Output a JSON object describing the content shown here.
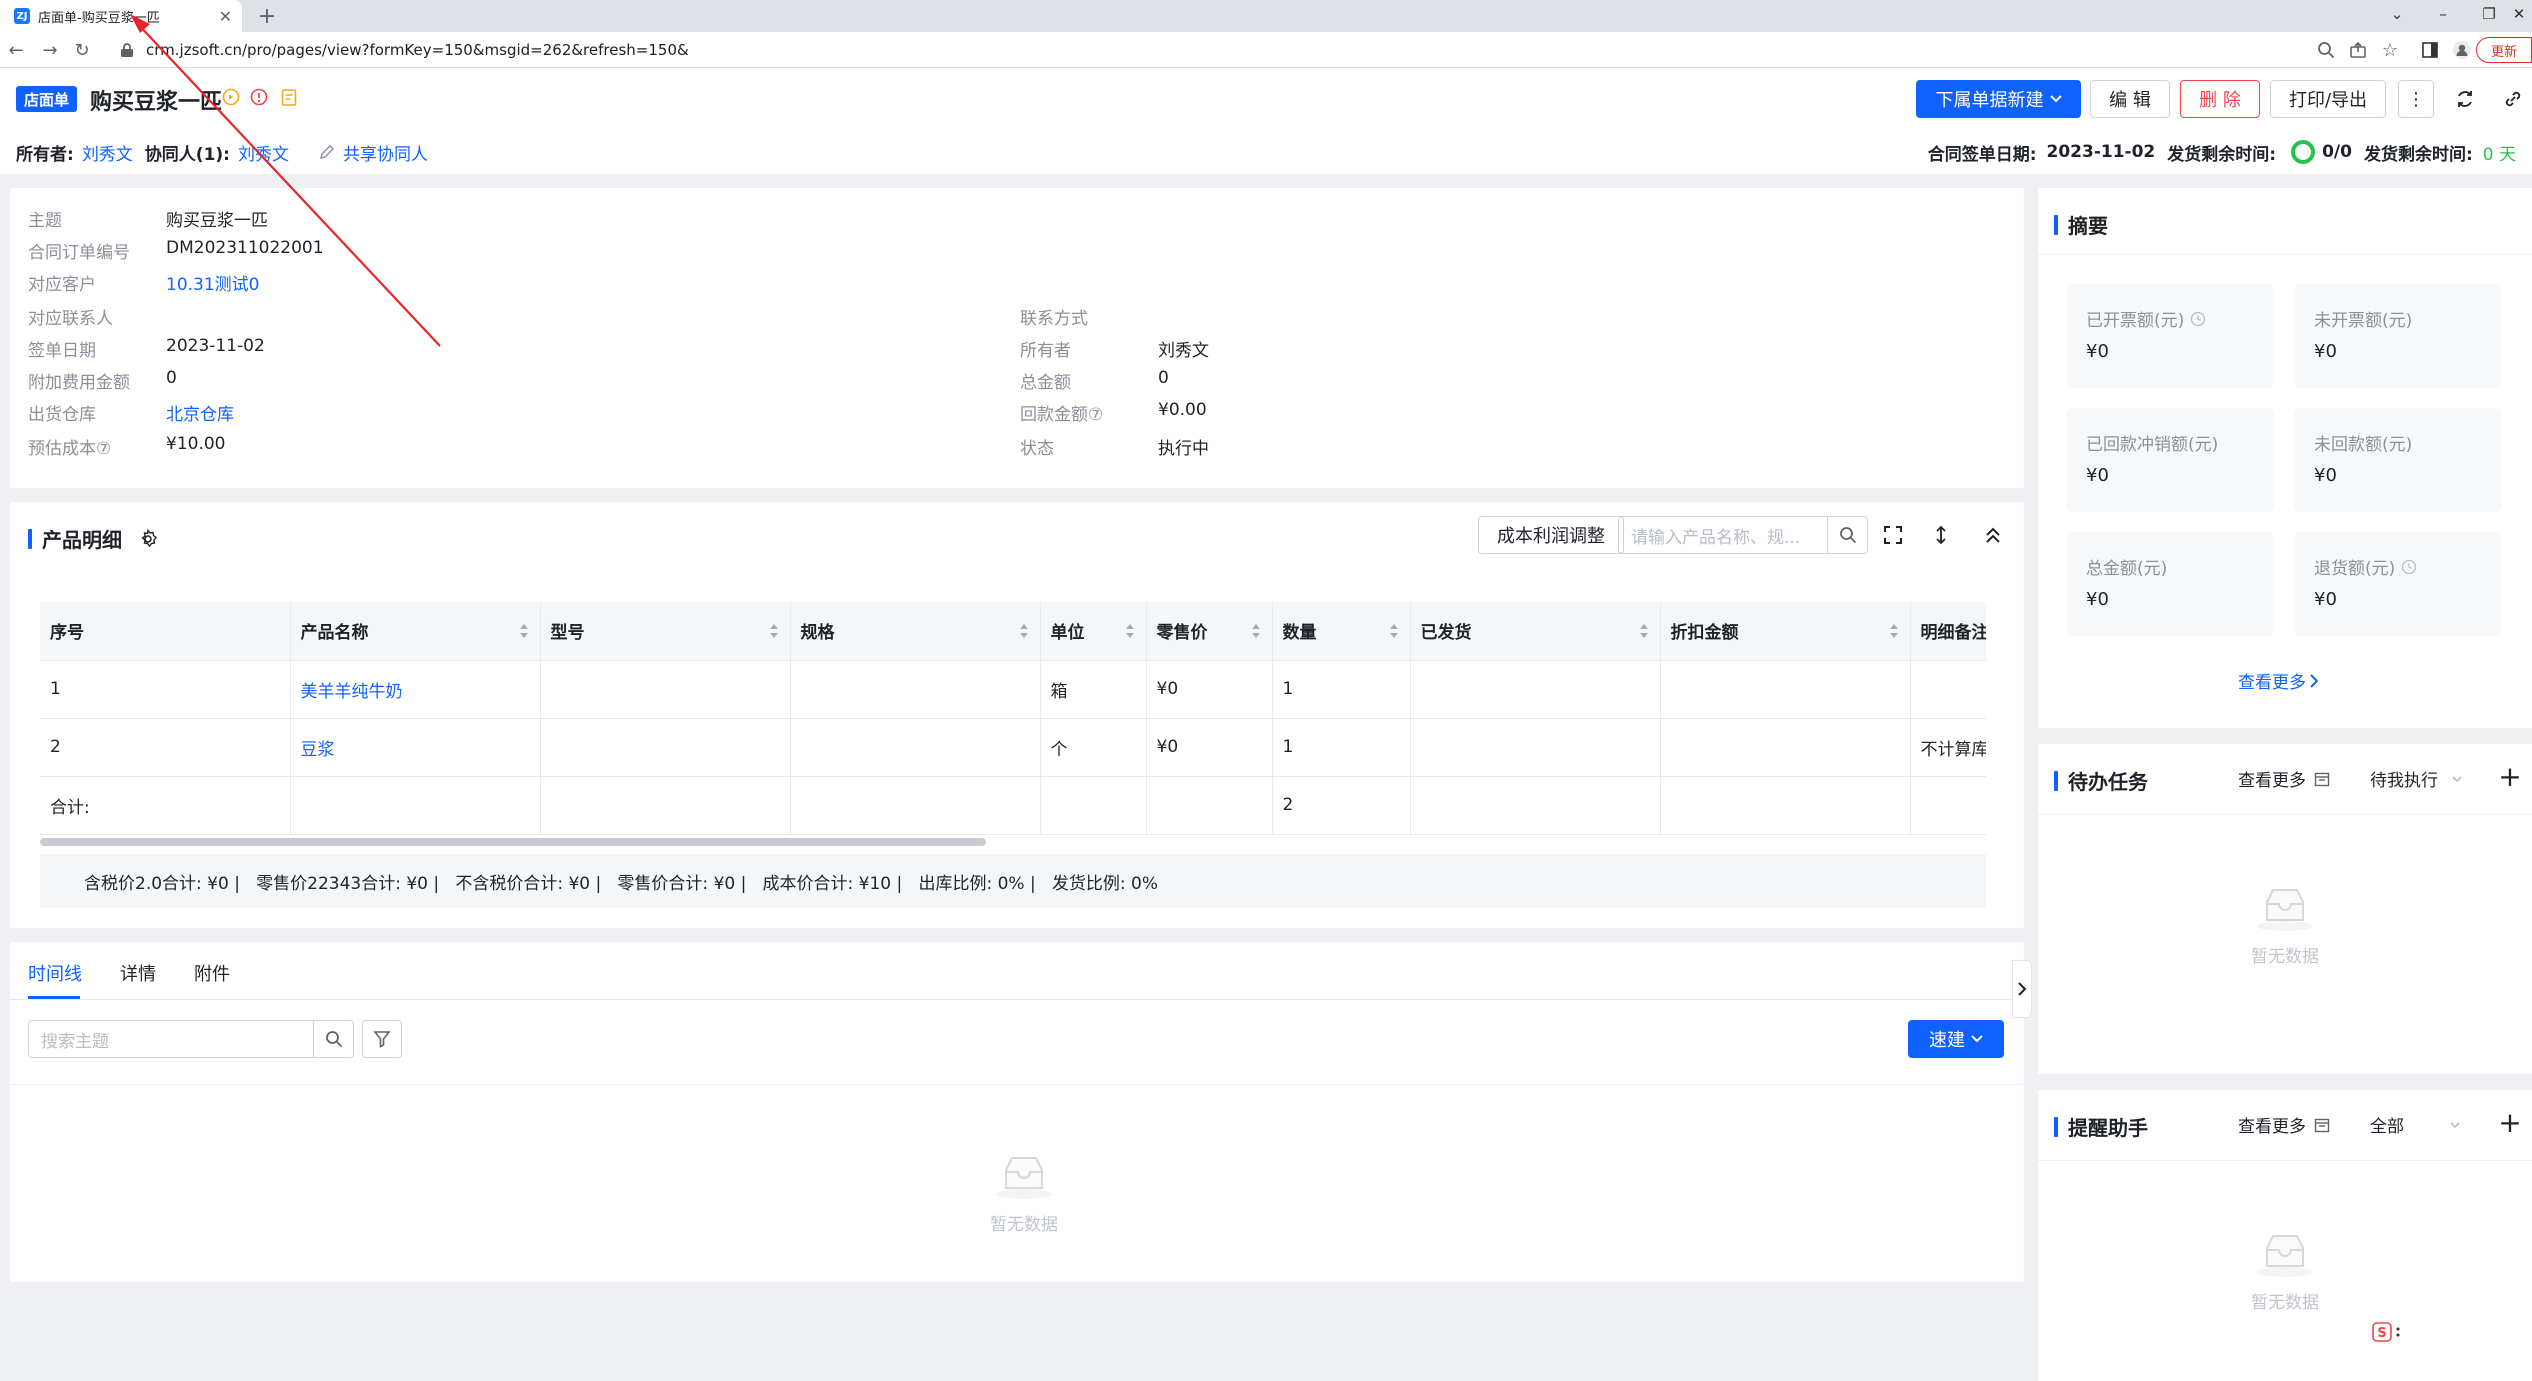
{
  "browser": {
    "tab_title": "店面单-购买豆浆一匹",
    "favicon_text": "ZJ",
    "url": "crm.jzsoft.cn/pro/pages/view?formKey=150&msgid=262&refresh=150&",
    "update_label": "更新",
    "icons": [
      "back-icon",
      "forward-icon",
      "reload-icon",
      "lock-icon",
      "zoom-icon",
      "share-icon",
      "star-icon",
      "sidebar-icon",
      "profile-icon"
    ]
  },
  "header": {
    "badge": "店面单",
    "title": "购买豆浆一匹",
    "buttons": {
      "new_child": "下属单据新建",
      "edit": "编 辑",
      "delete": "删 除",
      "print": "打印/导出"
    },
    "owner_label": "所有者:",
    "owner_value": "刘秀文",
    "collab_label": "协同人(1):",
    "collab_value": "刘秀文",
    "share_label": "共享协同人",
    "sign_date_label": "合同签单日期:",
    "sign_date_value": "2023-11-02",
    "ship_remain_label": "发货剩余时间:",
    "ship_progress": "0/0",
    "ship_remain_label2": "发货剩余时间:",
    "ship_remain_value": "0 天"
  },
  "info": {
    "left": [
      {
        "k": "主题",
        "v": "购买豆浆一匹",
        "link": false
      },
      {
        "k": "合同订单编号",
        "v": "DM202311022001",
        "link": false
      },
      {
        "k": "对应客户",
        "v": "10.31测试0",
        "link": true
      },
      {
        "k": "对应联系人",
        "v": "",
        "link": false
      },
      {
        "k": "签单日期",
        "v": "2023-11-02",
        "link": false
      },
      {
        "k": "附加费用金额",
        "v": "0",
        "link": false
      },
      {
        "k": "出货仓库",
        "v": "北京仓库",
        "link": true
      },
      {
        "k": "预估成本⑦",
        "v": "¥10.00",
        "link": false
      }
    ],
    "right": [
      {
        "k": "联系方式",
        "v": ""
      },
      {
        "k": "所有者",
        "v": "刘秀文"
      },
      {
        "k": "总金额",
        "v": "0"
      },
      {
        "k": "回款金额⑦",
        "v": "¥0.00"
      },
      {
        "k": "状态",
        "v": "执行中"
      }
    ]
  },
  "products": {
    "title": "产品明细",
    "cost_btn": "成本利润调整",
    "search_placeholder": "请输入产品名称、规...",
    "columns": [
      "序号",
      "产品名称",
      "型号",
      "规格",
      "单位",
      "零售价",
      "数量",
      "已发货",
      "折扣金额",
      "明细备注"
    ],
    "rows": [
      [
        "1",
        "美羊羊纯牛奶",
        "",
        "",
        "箱",
        "¥0",
        "1",
        "",
        "",
        ""
      ],
      [
        "2",
        "豆浆",
        "",
        "",
        "个",
        "¥0",
        "1",
        "",
        "",
        "不计算库"
      ]
    ],
    "total_row": [
      "合计:",
      "",
      "",
      "",
      "",
      "",
      "2",
      "",
      "",
      ""
    ],
    "summary": "含税价2.0合计: ¥0 |   零售价22343合计: ¥0 |   不含税价合计: ¥0 |   零售价合计: ¥0 |   成本价合计: ¥10 |   出库比例: 0% |   发货比例: 0%"
  },
  "timeline": {
    "tabs": [
      "时间线",
      "详情",
      "附件"
    ],
    "search_placeholder": "搜索主题",
    "quick_btn": "速建",
    "empty": "暂无数据"
  },
  "summary_panel": {
    "title": "摘要",
    "tiles": [
      {
        "label": "已开票额(元)",
        "value": "¥0",
        "clock": true
      },
      {
        "label": "未开票额(元)",
        "value": "¥0",
        "clock": false
      },
      {
        "label": "已回款冲销额(元)",
        "value": "¥0",
        "clock": false
      },
      {
        "label": "未回款额(元)",
        "value": "¥0",
        "clock": false
      },
      {
        "label": "总金额(元)",
        "value": "¥0",
        "clock": false
      },
      {
        "label": "退货额(元)",
        "value": "¥0",
        "clock": true
      }
    ],
    "see_more": "查看更多"
  },
  "todo_panel": {
    "title": "待办任务",
    "see_more": "查看更多",
    "filter": "待我执行",
    "empty": "暂无数据"
  },
  "reminder_panel": {
    "title": "提醒助手",
    "see_more": "查看更多",
    "filter": "全部",
    "empty": "暂无数据"
  },
  "colors": {
    "accent": "#1062ff",
    "danger": "#f0464a",
    "annotation": "#e8252b"
  }
}
